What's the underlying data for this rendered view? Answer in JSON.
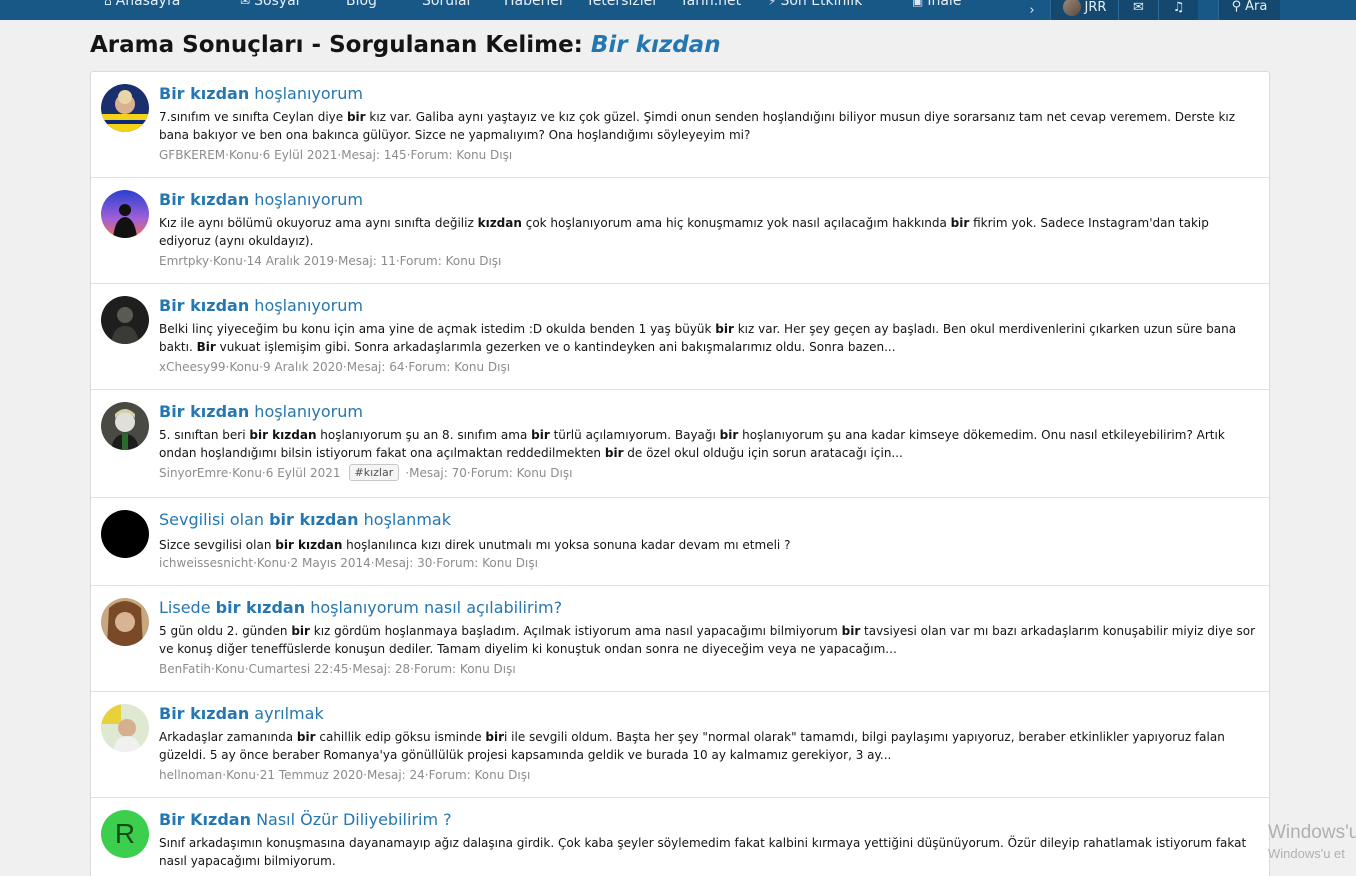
{
  "nav": {
    "items": [
      {
        "label": "Anasayfa",
        "icon": "home-icon"
      },
      {
        "label": "Sosyal",
        "icon": "chat-icon"
      },
      {
        "label": "Blog"
      },
      {
        "label": "Sorular"
      },
      {
        "label": "Haberler"
      },
      {
        "label": "Yetersizler"
      },
      {
        "label": "Yarın.net"
      },
      {
        "label": "Son Etkinlik",
        "icon": "activity-icon"
      },
      {
        "label": "Ihale",
        "icon": "box-icon"
      }
    ],
    "user": "JRR",
    "search_label": "Ara"
  },
  "page": {
    "title_prefix": "Arama Sonuçları - Sorgulanan Kelime:",
    "query": "Bir kızdan"
  },
  "results": [
    {
      "title": [
        {
          "t": "Bir kızdan",
          "b": true
        },
        {
          "t": " hoşlanıyorum",
          "b": false
        }
      ],
      "snippet": [
        {
          "t": "7.sınıfım ve sınıfta Ceylan diye ",
          "b": false
        },
        {
          "t": "bir",
          "b": true
        },
        {
          "t": " kız var. Galiba aynı yaştayız ve kız çok güzel. Şimdi onun senden hoşlandığını biliyor musun diye sorarsanız tam net cevap veremem. Derste kız bana bakıyor ve ben ona bakınca gülüyor. Sizce ne yapmalıyım? Ona hoşlandığımı söyleyeyim mi?",
          "b": false
        }
      ],
      "author": "GFBKEREM",
      "type": "Konu",
      "date": "6 Eylül 2021",
      "posts": "Mesaj: 145",
      "forum": "Forum: Konu Dışı",
      "tag": null
    },
    {
      "title": [
        {
          "t": "Bir kızdan",
          "b": true
        },
        {
          "t": " hoşlanıyorum",
          "b": false
        }
      ],
      "snippet": [
        {
          "t": "Kız ile aynı bölümü okuyoruz ama aynı sınıfta değiliz ",
          "b": false
        },
        {
          "t": "kızdan",
          "b": true
        },
        {
          "t": " çok hoşlanıyorum ama hiç konuşmamız yok nasıl açılacağım hakkında ",
          "b": false
        },
        {
          "t": "bir",
          "b": true
        },
        {
          "t": " fikrim yok. Sadece Instagram'dan takip ediyoruz (aynı okuldayız).",
          "b": false
        }
      ],
      "author": "Emrtpky",
      "type": "Konu",
      "date": "14 Aralık 2019",
      "posts": "Mesaj: 11",
      "forum": "Forum: Konu Dışı",
      "tag": null
    },
    {
      "title": [
        {
          "t": "Bir kızdan",
          "b": true
        },
        {
          "t": " hoşlanıyorum",
          "b": false
        }
      ],
      "snippet": [
        {
          "t": "Belki linç yiyeceğim bu konu için ama yine de açmak istedim :D okulda benden 1 yaş büyük ",
          "b": false
        },
        {
          "t": "bir",
          "b": true
        },
        {
          "t": " kız var. Her şey geçen ay başladı. Ben okul merdivenlerini çıkarken uzun süre bana baktı. ",
          "b": false
        },
        {
          "t": "Bir",
          "b": true
        },
        {
          "t": " vukuat işlemişim gibi. Sonra arkadaşlarımla gezerken ve o kantindeyken ani bakışmalarımız oldu. Sonra bazen...",
          "b": false
        }
      ],
      "author": "xCheesy99",
      "type": "Konu",
      "date": "9 Aralık 2020",
      "posts": "Mesaj: 64",
      "forum": "Forum: Konu Dışı",
      "tag": null
    },
    {
      "title": [
        {
          "t": "Bir kızdan",
          "b": true
        },
        {
          "t": " hoşlanıyorum",
          "b": false
        }
      ],
      "snippet": [
        {
          "t": "5. sınıftan beri ",
          "b": false
        },
        {
          "t": "bir kızdan",
          "b": true
        },
        {
          "t": " hoşlanıyorum şu an 8. sınıfım ama ",
          "b": false
        },
        {
          "t": "bir",
          "b": true
        },
        {
          "t": " türlü açılamıyorum. Bayağı ",
          "b": false
        },
        {
          "t": "bir",
          "b": true
        },
        {
          "t": " hoşlanıyorum şu ana kadar kimseye dökemedim. Onu nasıl etkileyebilirim? Artık ondan hoşlandığımı bilsin istiyorum fakat ona açılmaktan reddedilmekten ",
          "b": false
        },
        {
          "t": "bir",
          "b": true
        },
        {
          "t": " de özel okul olduğu için sorun aratacağı için...",
          "b": false
        }
      ],
      "author": "SinyorEmre",
      "type": "Konu",
      "date": "6 Eylül 2021",
      "posts": "Mesaj: 70",
      "forum": "Forum: Konu Dışı",
      "tag": "#kızlar"
    },
    {
      "title": [
        {
          "t": "Sevgilisi olan ",
          "b": false
        },
        {
          "t": "bir kızdan",
          "b": true
        },
        {
          "t": " hoşlanmak",
          "b": false
        }
      ],
      "snippet": [
        {
          "t": "Sizce sevgilisi olan ",
          "b": false
        },
        {
          "t": "bir kızdan",
          "b": true
        },
        {
          "t": " hoşlanılınca kızı direk unutmalı mı yoksa sonuna kadar devam mı etmeli ?",
          "b": false
        }
      ],
      "author": "ichweissesnicht",
      "type": "Konu",
      "date": "2 Mayıs 2014",
      "posts": "Mesaj: 30",
      "forum": "Forum: Konu Dışı",
      "tag": null
    },
    {
      "title": [
        {
          "t": "Lisede ",
          "b": false
        },
        {
          "t": "bir kızdan",
          "b": true
        },
        {
          "t": " hoşlanıyorum nasıl açılabilirim?",
          "b": false
        }
      ],
      "snippet": [
        {
          "t": "5 gün oldu 2. günden ",
          "b": false
        },
        {
          "t": "bir",
          "b": true
        },
        {
          "t": " kız gördüm hoşlanmaya başladım. Açılmak istiyorum ama nasıl yapacağımı bilmiyorum ",
          "b": false
        },
        {
          "t": "bir",
          "b": true
        },
        {
          "t": " tavsiyesi olan var mı bazı arkadaşlarım konuşabilir miyiz diye sor ve konuş diğer teneffüslerde konuşun dediler. Tamam diyelim ki konuştuk ondan sonra ne diyeceğim veya ne yapacağım...",
          "b": false
        }
      ],
      "author": "BenFatih",
      "type": "Konu",
      "date": "Cumartesi 22:45",
      "posts": "Mesaj: 28",
      "forum": "Forum: Konu Dışı",
      "tag": null
    },
    {
      "title": [
        {
          "t": "Bir kızdan",
          "b": true
        },
        {
          "t": " ayrılmak",
          "b": false
        }
      ],
      "snippet": [
        {
          "t": "Arkadaşlar zamanında ",
          "b": false
        },
        {
          "t": "bir",
          "b": true
        },
        {
          "t": " cahillik edip göksu isminde ",
          "b": false
        },
        {
          "t": "bir",
          "b": true
        },
        {
          "t": "i ile sevgili oldum. Başta her şey \"normal olarak\" tamamdı, bilgi paylaşımı yapıyoruz, beraber etkinlikler yapıyoruz falan güzeldi. 5 ay önce beraber Romanya'ya gönüllülük projesi kapsamında geldik ve burada 10 ay kalmamız gerekiyor, 3 ay...",
          "b": false
        }
      ],
      "author": "hellnoman",
      "type": "Konu",
      "date": "21 Temmuz 2020",
      "posts": "Mesaj: 24",
      "forum": "Forum: Konu Dışı",
      "tag": null
    },
    {
      "title": [
        {
          "t": "Bir Kızdan",
          "b": true
        },
        {
          "t": " Nasıl Özür Diliyebilirim ?",
          "b": false
        }
      ],
      "snippet": [
        {
          "t": "Sınıf arkadaşımın konuşmasına dayanamayıp ağız dalaşına girdik. Çok kaba şeyler söylemedim fakat kalbini kırmaya yettiğini düşünüyorum. Özür dileyip rahatlamak istiyorum fakat nasıl yapacağımı bilmiyorum.",
          "b": false
        }
      ],
      "author": "",
      "type": "",
      "date": "",
      "posts": "",
      "forum": "",
      "tag": null,
      "avatar_letter": "R"
    }
  ],
  "watermark": {
    "line1": "Windows'u",
    "line2": "Windows'u et"
  },
  "colors": {
    "nav_bg": "#185886",
    "link": "#2577b1",
    "meta": "#8c8c8c",
    "avatar_green": "#3ccf4e"
  }
}
